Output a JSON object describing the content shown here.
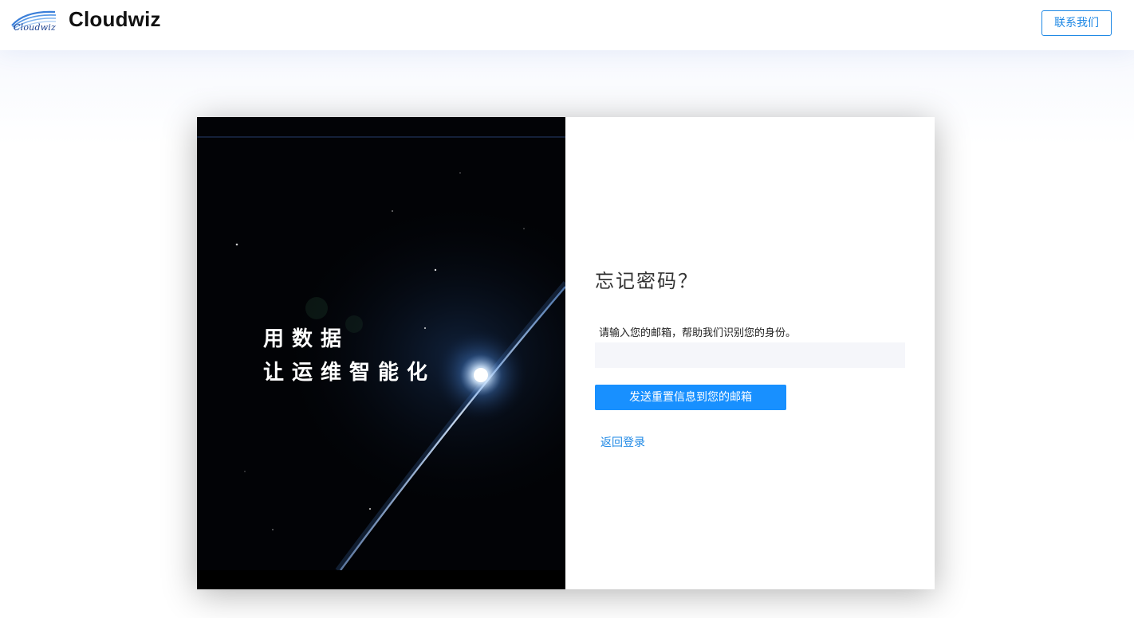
{
  "header": {
    "logo_text": "Cloudwiz",
    "brand_name": "Cloudwiz",
    "contact_label": "联系我们"
  },
  "hero": {
    "slogan_line1": "用数据",
    "slogan_line2": "让运维智能化"
  },
  "form": {
    "title": "忘记密码？",
    "hint": "请输入您的邮箱，帮助我们识别您的身份。",
    "email_value": "",
    "email_placeholder": "",
    "submit_label": "发送重置信息到您的邮箱",
    "back_label": "返回登录"
  },
  "colors": {
    "accent": "#1890ff",
    "link": "#1e88e5",
    "hero_background": "#020306"
  }
}
